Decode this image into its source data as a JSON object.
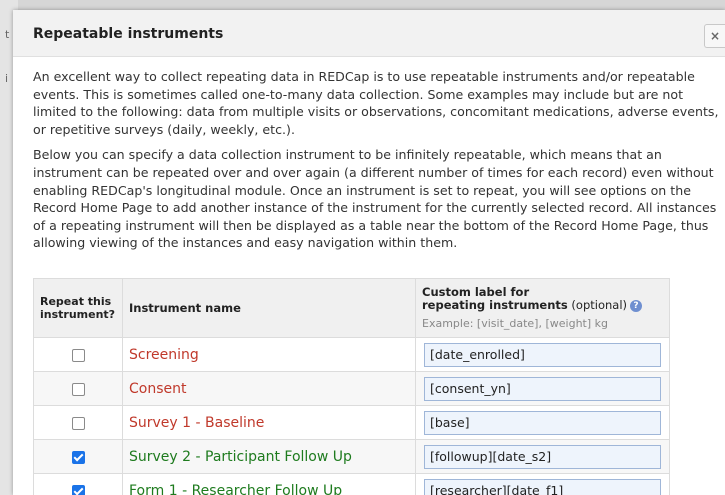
{
  "dialog": {
    "title": "Repeatable instruments",
    "close_glyph": "×"
  },
  "paragraphs": [
    "An excellent way to collect repeating data in REDCap is to use repeatable instruments and/or repeatable events. This is sometimes called one-to-many data collection. Some examples may include but are not limited to the following: data from multiple visits or observations, concomitant medications, adverse events, or repetitive surveys (daily, weekly, etc.).",
    "Below you can specify a data collection instrument to be infinitely repeatable, which means that an instrument can be repeated over and over again (a different number of times for each record) even without enabling REDCap's longitudinal module. Once an instrument is set to repeat, you will see options on the Record Home Page to add another instance of the instrument for the currently selected record. All instances of a repeating instrument will then be displayed as a table near the bottom of the Record Home Page, thus allowing viewing of the instances and easy navigation within them."
  ],
  "table": {
    "header": {
      "repeat_line1": "Repeat this",
      "repeat_line2": "instrument?",
      "name": "Instrument name",
      "label_line1": "Custom label for",
      "label_line2_bold": "repeating instruments",
      "label_optional": " (optional)",
      "example": "Example: [visit_date], [weight] kg"
    },
    "rows": [
      {
        "checked": false,
        "name": "Screening",
        "label": "[date_enrolled]"
      },
      {
        "checked": false,
        "name": "Consent",
        "label": "[consent_yn]"
      },
      {
        "checked": false,
        "name": "Survey 1 - Baseline",
        "label": "[base]"
      },
      {
        "checked": true,
        "name": "Survey 2 - Participant Follow Up",
        "label": "[followup][date_s2]"
      },
      {
        "checked": true,
        "name": "Form 1 - Researcher Follow Up",
        "label": "[researcher][date_f1]"
      }
    ]
  },
  "colors": {
    "unchecked_name": "#c0392b",
    "checked_name": "#1e7b1e",
    "checkbox_checked": "#1a73e8"
  },
  "icons": {
    "help": "help-icon",
    "close": "close-icon"
  }
}
